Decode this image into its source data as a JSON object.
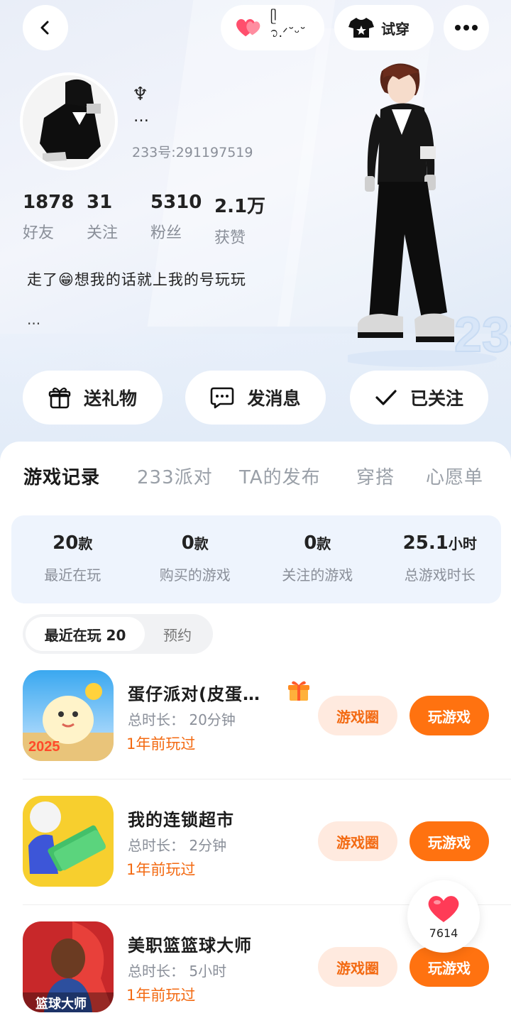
{
  "header": {
    "back_icon": "chevron-left-icon",
    "mood_label": "ᥫ᭡.ᐟ˘ᵕ˘",
    "try_on_label": "试穿",
    "more_icon": "more-dots-icon"
  },
  "profile": {
    "name_symbol": "♆",
    "nickname": "…",
    "user_id": "233号:291197519",
    "stats": [
      {
        "value": "1878",
        "label": "好友"
      },
      {
        "value": "31",
        "label": "关注"
      },
      {
        "value": "5310",
        "label": "粉丝"
      },
      {
        "value": "2.1万",
        "label": "获赞"
      }
    ],
    "bio": "走了😁想我的话就上我的号玩玩",
    "bio_more": "..."
  },
  "actions": {
    "gift": "送礼物",
    "message": "发消息",
    "followed": "已关注"
  },
  "tabs": [
    "游戏记录",
    "233派对",
    "TA的发布",
    "穿搭",
    "心愿单"
  ],
  "summary": [
    {
      "value": "20",
      "unit": "款",
      "label": "最近在玩"
    },
    {
      "value": "0",
      "unit": "款",
      "label": "购买的游戏"
    },
    {
      "value": "0",
      "unit": "款",
      "label": "关注的游戏"
    },
    {
      "value": "25.1",
      "unit": "小时",
      "label": "总游戏时长"
    }
  ],
  "segment": {
    "active": "最近在玩 20",
    "inactive": "预约"
  },
  "games": [
    {
      "name": "蛋仔派对(皮蛋…",
      "duration": "总时长：  20分钟",
      "last_played": "1年前玩过",
      "circle": "游戏圈",
      "play": "玩游戏",
      "has_gift": true
    },
    {
      "name": "我的连锁超市",
      "duration": "总时长：  2分钟",
      "last_played": "1年前玩过",
      "circle": "游戏圈",
      "play": "玩游戏"
    },
    {
      "name": "美职篮篮球大师",
      "duration": "总时长：  5小时",
      "last_played": "1年前玩过",
      "circle": "游戏圈",
      "play": "玩游戏"
    }
  ],
  "like_count": "7614",
  "colors": {
    "accent": "#ff7210",
    "accent_light": "#ffeadf",
    "heart": "#ff3b57"
  }
}
